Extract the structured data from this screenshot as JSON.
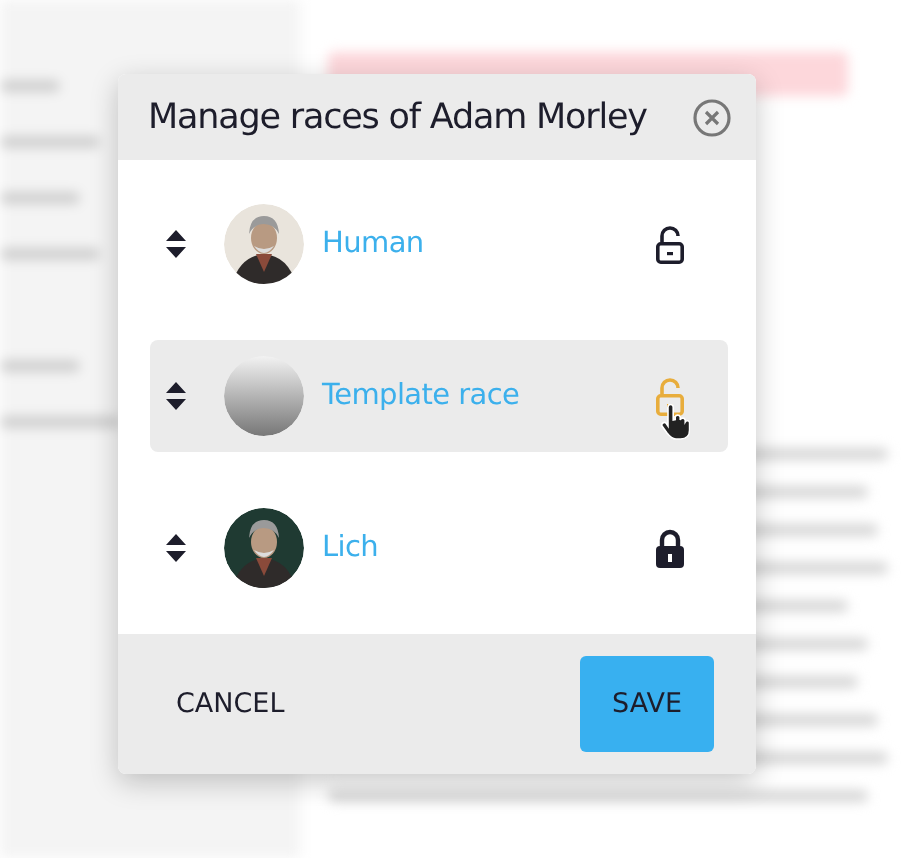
{
  "dialog": {
    "title": "Manage races of Adam Morley",
    "races": [
      {
        "name": "Human",
        "locked": false,
        "highlighted": false
      },
      {
        "name": "Template race",
        "avatar": {
          "kind": "placeholder"
        },
        "locked": false,
        "highlighted": true
      },
      {
        "name": "Lich",
        "locked": true,
        "highlighted": false
      }
    ],
    "buttons": [
      {
        "label": "CANCEL",
        "kind": "text"
      },
      {
        "label": "SAVE",
        "kind": "primary"
      }
    ]
  }
}
